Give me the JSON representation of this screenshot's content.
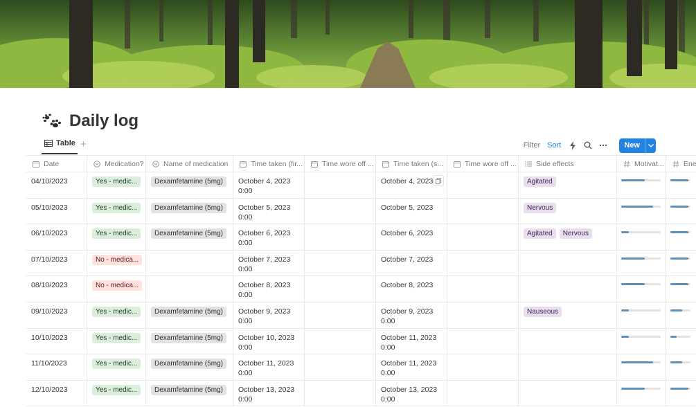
{
  "page": {
    "title": "Daily log",
    "icon": "paw-prints-icon"
  },
  "view": {
    "tab_label": "Table",
    "tab_icon": "table-icon",
    "add_view_label": "+",
    "filter_label": "Filter",
    "sort_label": "Sort",
    "new_label": "New"
  },
  "columns": [
    {
      "label": "Date",
      "icon": "calendar-icon"
    },
    {
      "label": "Medication?",
      "icon": "select-icon"
    },
    {
      "label": "Name of medication",
      "icon": "select-icon"
    },
    {
      "label": "Time taken (fir...",
      "icon": "calendar-icon"
    },
    {
      "label": "Time wore off ...",
      "icon": "calendar-icon"
    },
    {
      "label": "Time taken (s...",
      "icon": "calendar-icon"
    },
    {
      "label": "Time wore off ...",
      "icon": "calendar-icon"
    },
    {
      "label": "Side effects",
      "icon": "list-icon"
    },
    {
      "label": "Motivat...",
      "icon": "number-icon"
    },
    {
      "label": "Energ",
      "icon": "number-icon"
    }
  ],
  "rows": [
    {
      "date": "04/10/2023",
      "med": "Yes - medic...",
      "med_color": "green",
      "name": "Dexamfetamine (5mg)",
      "t1a": "October 4, 2023",
      "t1b": "0:00",
      "t2a": "October 4, 2023",
      "t2b": "",
      "effects": [
        "Agitated"
      ],
      "motivation": 0.6,
      "energy": 0.9
    },
    {
      "date": "05/10/2023",
      "med": "Yes - medic...",
      "med_color": "green",
      "name": "Dexamfetamine (5mg)",
      "t1a": "October 5, 2023",
      "t1b": "0:00",
      "t2a": "October 5, 2023",
      "t2b": "",
      "effects": [
        "Nervous"
      ],
      "motivation": 0.8,
      "energy": 0.9
    },
    {
      "date": "06/10/2023",
      "med": "Yes - medic...",
      "med_color": "green",
      "name": "Dexamfetamine (5mg)",
      "t1a": "October 6, 2023",
      "t1b": "0:00",
      "t2a": "October 6, 2023",
      "t2b": "",
      "effects": [
        "Agitated",
        "Nervous"
      ],
      "motivation": 0.2,
      "energy": 0.9
    },
    {
      "date": "07/10/2023",
      "med": "No - medica...",
      "med_color": "red",
      "name": "",
      "t1a": "October 7, 2023",
      "t1b": "0:00",
      "t2a": "October 7, 2023",
      "t2b": "",
      "effects": [],
      "motivation": 0.6,
      "energy": 0.9
    },
    {
      "date": "08/10/2023",
      "med": "No - medica...",
      "med_color": "red",
      "name": "",
      "t1a": "October 8, 2023",
      "t1b": "0:00",
      "t2a": "October 8, 2023",
      "t2b": "",
      "effects": [],
      "motivation": 0.6,
      "energy": 0.9
    },
    {
      "date": "09/10/2023",
      "med": "Yes - medic...",
      "med_color": "green",
      "name": "Dexamfetamine (5mg)",
      "t1a": "October 9, 2023",
      "t1b": "0:00",
      "t2a": "October 9, 2023",
      "t2b": "0:00",
      "effects": [
        "Nauseous"
      ],
      "motivation": 0.2,
      "energy": 0.6
    },
    {
      "date": "10/10/2023",
      "med": "Yes - medic...",
      "med_color": "green",
      "name": "Dexamfetamine (5mg)",
      "t1a": "October 10, 2023",
      "t1b": "0:00",
      "t2a": "October 11, 2023",
      "t2b": "0:00",
      "effects": [],
      "motivation": 0.2,
      "energy": 0.3
    },
    {
      "date": "11/10/2023",
      "med": "Yes - medic...",
      "med_color": "green",
      "name": "Dexamfetamine (5mg)",
      "t1a": "October 11, 2023",
      "t1b": "0:00",
      "t2a": "October 11, 2023",
      "t2b": "0:00",
      "effects": [],
      "motivation": 0.8,
      "energy": 0.6
    },
    {
      "date": "12/10/2023",
      "med": "Yes - medic...",
      "med_color": "green",
      "name": "Dexamfetamine (5mg)",
      "t1a": "October 13, 2023",
      "t1b": "0:00",
      "t2a": "October 13, 2023",
      "t2b": "0:00",
      "effects": [],
      "motivation": 0.6,
      "energy": 0.9
    }
  ],
  "colors": {
    "accent": "#2383e2",
    "progress": "#5d8fbd",
    "green_tag": "#dbeddb",
    "red_tag": "#ffe2dd",
    "purple_tag": "#e8deee",
    "gray_tag": "#e3e2e0"
  }
}
